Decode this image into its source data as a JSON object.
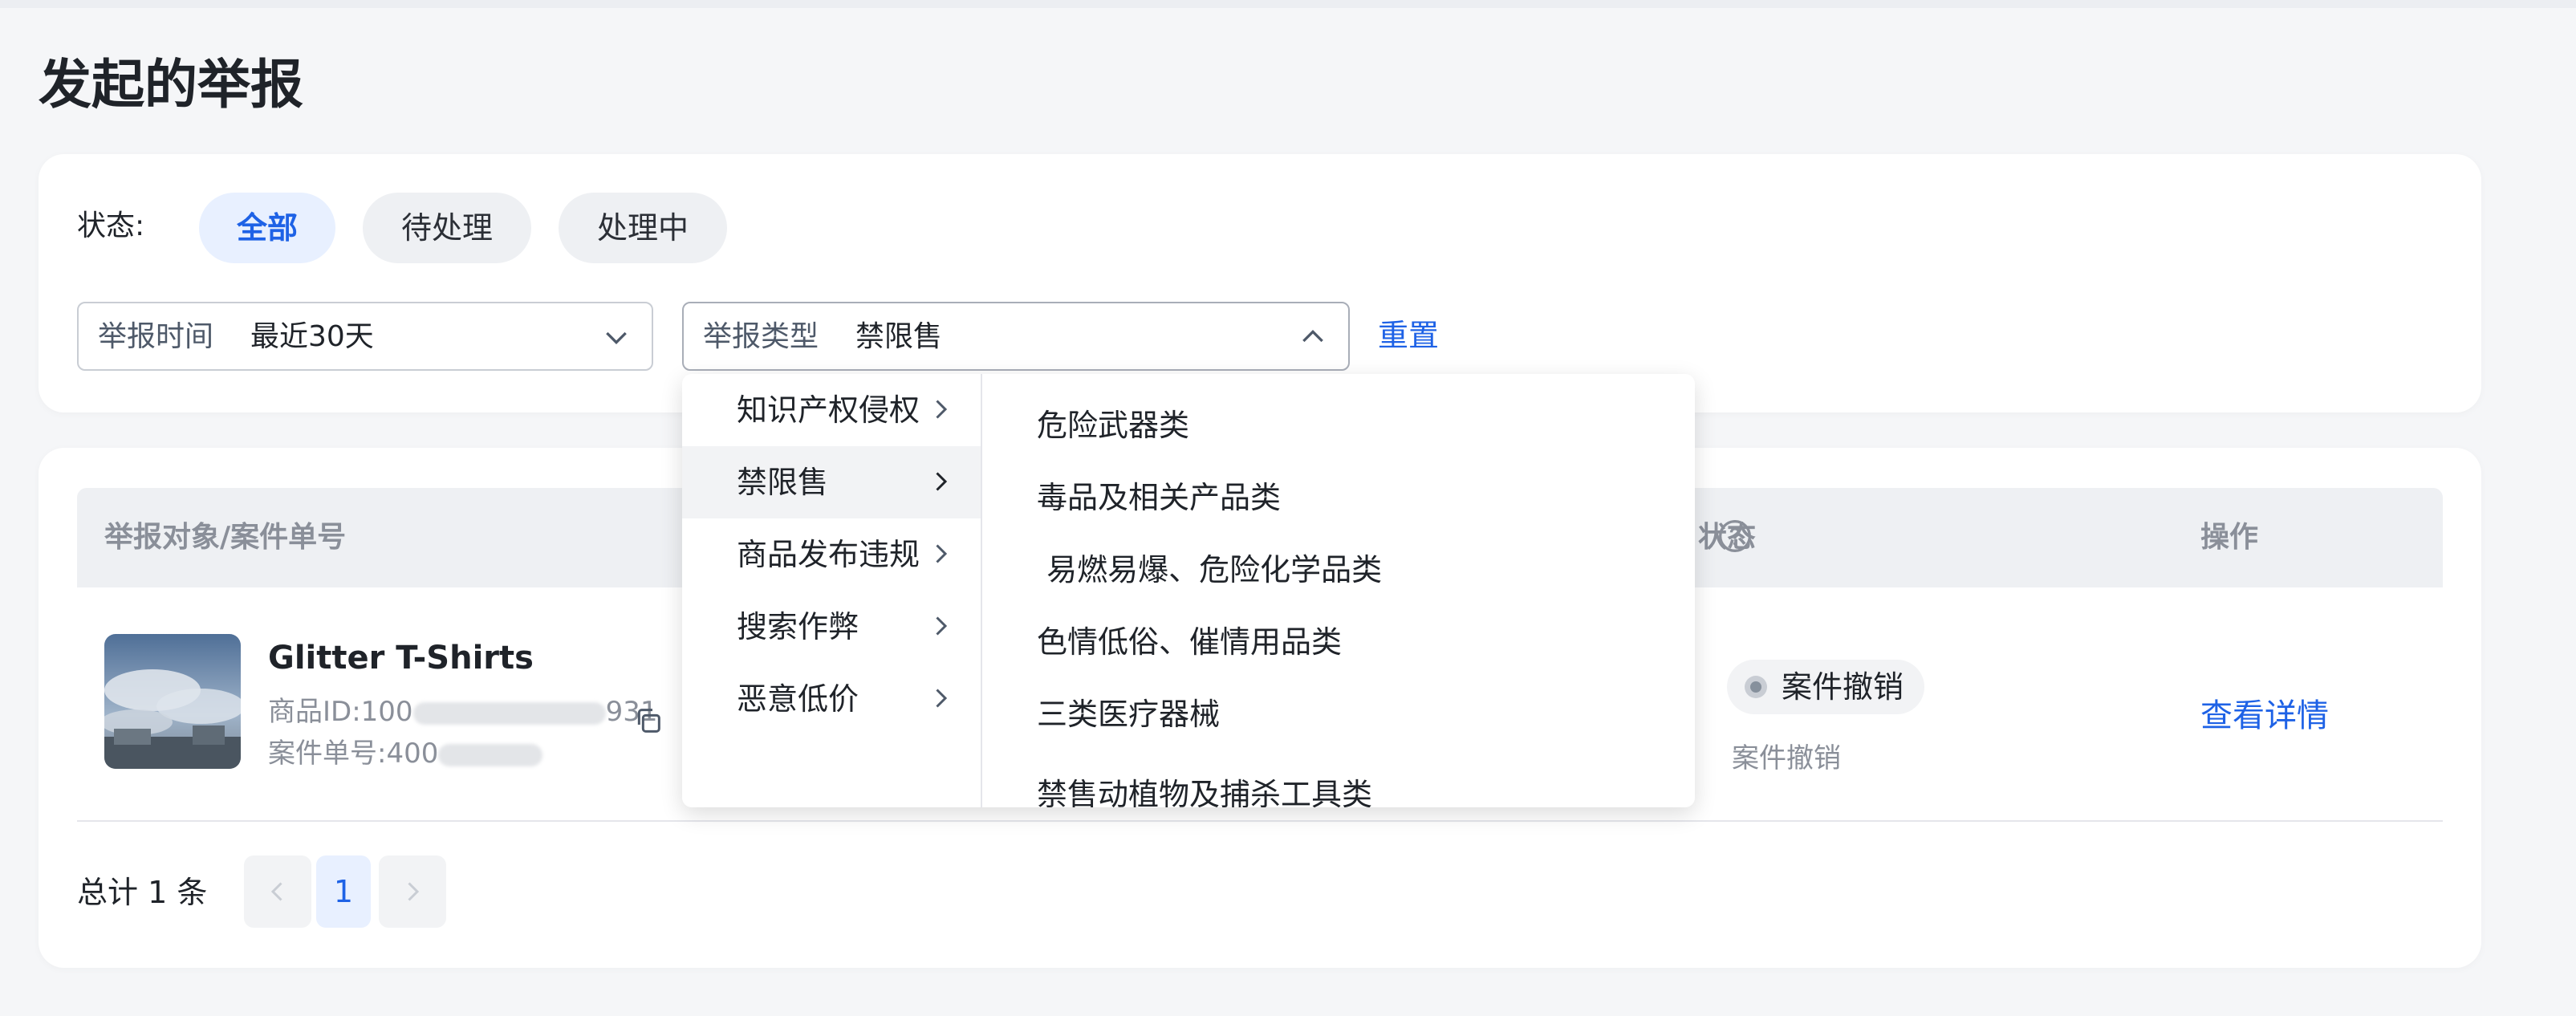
{
  "page": {
    "title": "发起的举报"
  },
  "filters": {
    "status_label": "状态:",
    "chips": [
      "全部",
      "待处理",
      "处理中"
    ],
    "time_select": {
      "label": "举报时间",
      "value": "最近30天"
    },
    "type_select": {
      "label": "举报类型",
      "value": "禁限售"
    },
    "reset": "重置"
  },
  "table": {
    "headers": {
      "target": "举报对象/案件单号",
      "status": "状态",
      "action": "操作"
    },
    "rows": [
      {
        "product_name": "Glitter T-Shirts",
        "product_id_label": "商品ID:",
        "product_id_prefix": "100",
        "product_id_suffix": "931",
        "case_label": "案件单号:",
        "case_prefix": "400",
        "status": "案件撤销",
        "status_sub": "案件撤销",
        "action": "查看详情"
      }
    ]
  },
  "pagination": {
    "total": "总计 1 条",
    "current": "1"
  },
  "dropdown": {
    "categories": [
      "知识产权侵权",
      "禁限售",
      "商品发布违规",
      "搜索作弊",
      "恶意低价"
    ],
    "active_category": "禁限售",
    "options": [
      "危险武器类",
      "毒品及相关产品类",
      " 易燃易爆、危险化学品类",
      "色情低俗、催情用品类",
      "三类医疗器械",
      "禁售动植物及捕杀工具类"
    ]
  },
  "colors": {
    "accent": "#1e62e6",
    "background": "#f5f6f8"
  }
}
